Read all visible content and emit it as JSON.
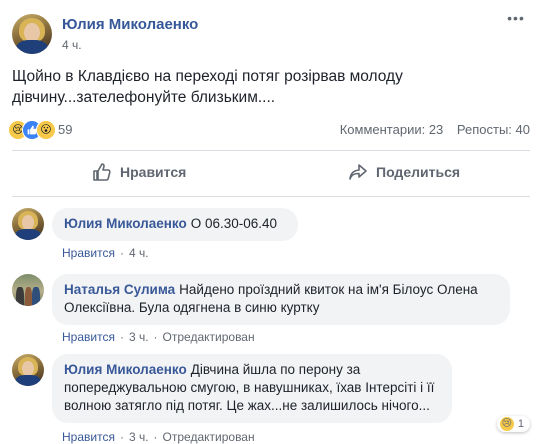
{
  "post": {
    "author": "Юлия Миколаенко",
    "time": "4 ч.",
    "more_icon": "ellipsis-icon",
    "text": "Щойно в Клавдієво на переході потяг розірвав молоду дівчину...зателефонуйте близьким....",
    "reactions": {
      "icons": [
        "sad-icon",
        "like-icon",
        "wow-icon"
      ],
      "count": "59"
    },
    "comments_stat": "Комментарии: 23",
    "reposts_stat": "Репосты: 40"
  },
  "actions": {
    "like_label": "Нравится",
    "share_label": "Поделиться",
    "like_icon": "thumbs-up-icon",
    "share_icon": "share-arrow-icon"
  },
  "comments": [
    {
      "author": "Юлия Миколаенко",
      "text": "О 06.30-06.40",
      "like": "Нравится",
      "time": "4 ч.",
      "edited": ""
    },
    {
      "author": "Наталья Сулима",
      "text": "Найдено проїздний квиток на ім'я Білоус Олена Олексіївна. Була одягнена в синю куртку",
      "like": "Нравится",
      "time": "3 ч.",
      "edited": "Отредактирован"
    },
    {
      "author": "Юлия Миколаенко",
      "text": "Дівчина йшла по перону за попереджувальною смугою, в навушниках, їхав Інтерсіті і її волною затягло під потяг. Це жах...не залишилось нічого...",
      "like": "Нравится",
      "time": "3 ч.",
      "edited": "Отредактирован",
      "reaction_count": "1"
    }
  ],
  "colors": {
    "link": "#385898",
    "author": "#365899",
    "muted": "#606770",
    "bubble": "#f2f3f5",
    "divider": "#dadde1"
  }
}
